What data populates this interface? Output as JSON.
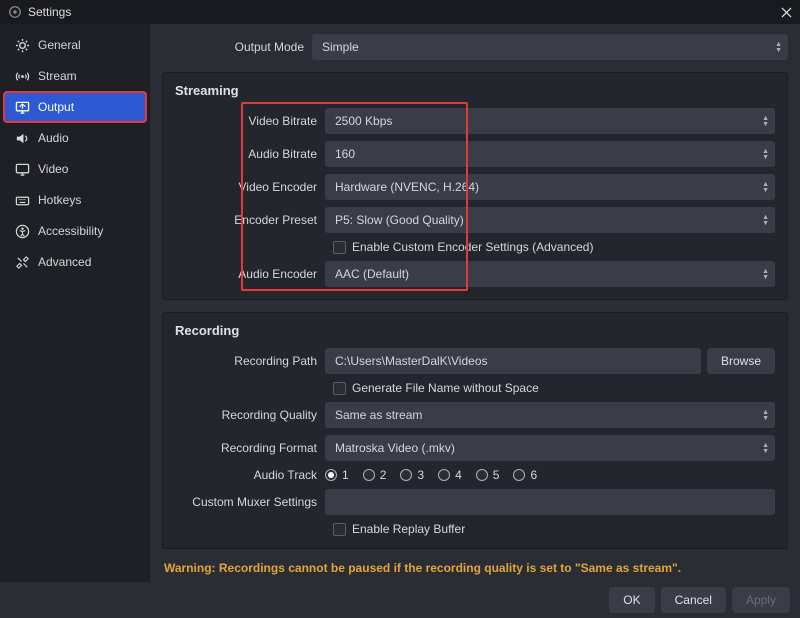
{
  "window": {
    "title": "Settings"
  },
  "sidebar": {
    "items": [
      {
        "icon": "gear",
        "label": "General"
      },
      {
        "icon": "antenna",
        "label": "Stream"
      },
      {
        "icon": "monitor-out",
        "label": "Output",
        "selected": true,
        "highlighted": true
      },
      {
        "icon": "speaker",
        "label": "Audio"
      },
      {
        "icon": "monitor",
        "label": "Video"
      },
      {
        "icon": "keyboard",
        "label": "Hotkeys"
      },
      {
        "icon": "accessibility",
        "label": "Accessibility"
      },
      {
        "icon": "tools",
        "label": "Advanced"
      }
    ]
  },
  "output_mode": {
    "label": "Output Mode",
    "value": "Simple"
  },
  "streaming": {
    "title": "Streaming",
    "video_bitrate": {
      "label": "Video Bitrate",
      "value": "2500 Kbps"
    },
    "audio_bitrate": {
      "label": "Audio Bitrate",
      "value": "160"
    },
    "video_encoder": {
      "label": "Video Encoder",
      "value": "Hardware (NVENC, H.264)"
    },
    "encoder_preset": {
      "label": "Encoder Preset",
      "value": "P5: Slow (Good Quality)"
    },
    "custom_encoder": {
      "label": "Enable Custom Encoder Settings (Advanced)"
    },
    "audio_encoder": {
      "label": "Audio Encoder",
      "value": "AAC (Default)"
    }
  },
  "recording": {
    "title": "Recording",
    "path": {
      "label": "Recording Path",
      "value": "C:\\Users\\MasterDalK\\Videos"
    },
    "browse": "Browse",
    "no_space": {
      "label": "Generate File Name without Space"
    },
    "quality": {
      "label": "Recording Quality",
      "value": "Same as stream"
    },
    "format": {
      "label": "Recording Format",
      "value": "Matroska Video (.mkv)"
    },
    "audio_track": {
      "label": "Audio Track",
      "tracks": [
        "1",
        "2",
        "3",
        "4",
        "5",
        "6"
      ],
      "selected": 1
    },
    "muxer": {
      "label": "Custom Muxer Settings",
      "value": ""
    },
    "replay_buffer": {
      "label": "Enable Replay Buffer"
    }
  },
  "warning": "Warning: Recordings cannot be paused if the recording quality is set to \"Same as stream\".",
  "buttons": {
    "ok": "OK",
    "cancel": "Cancel",
    "apply": "Apply"
  }
}
